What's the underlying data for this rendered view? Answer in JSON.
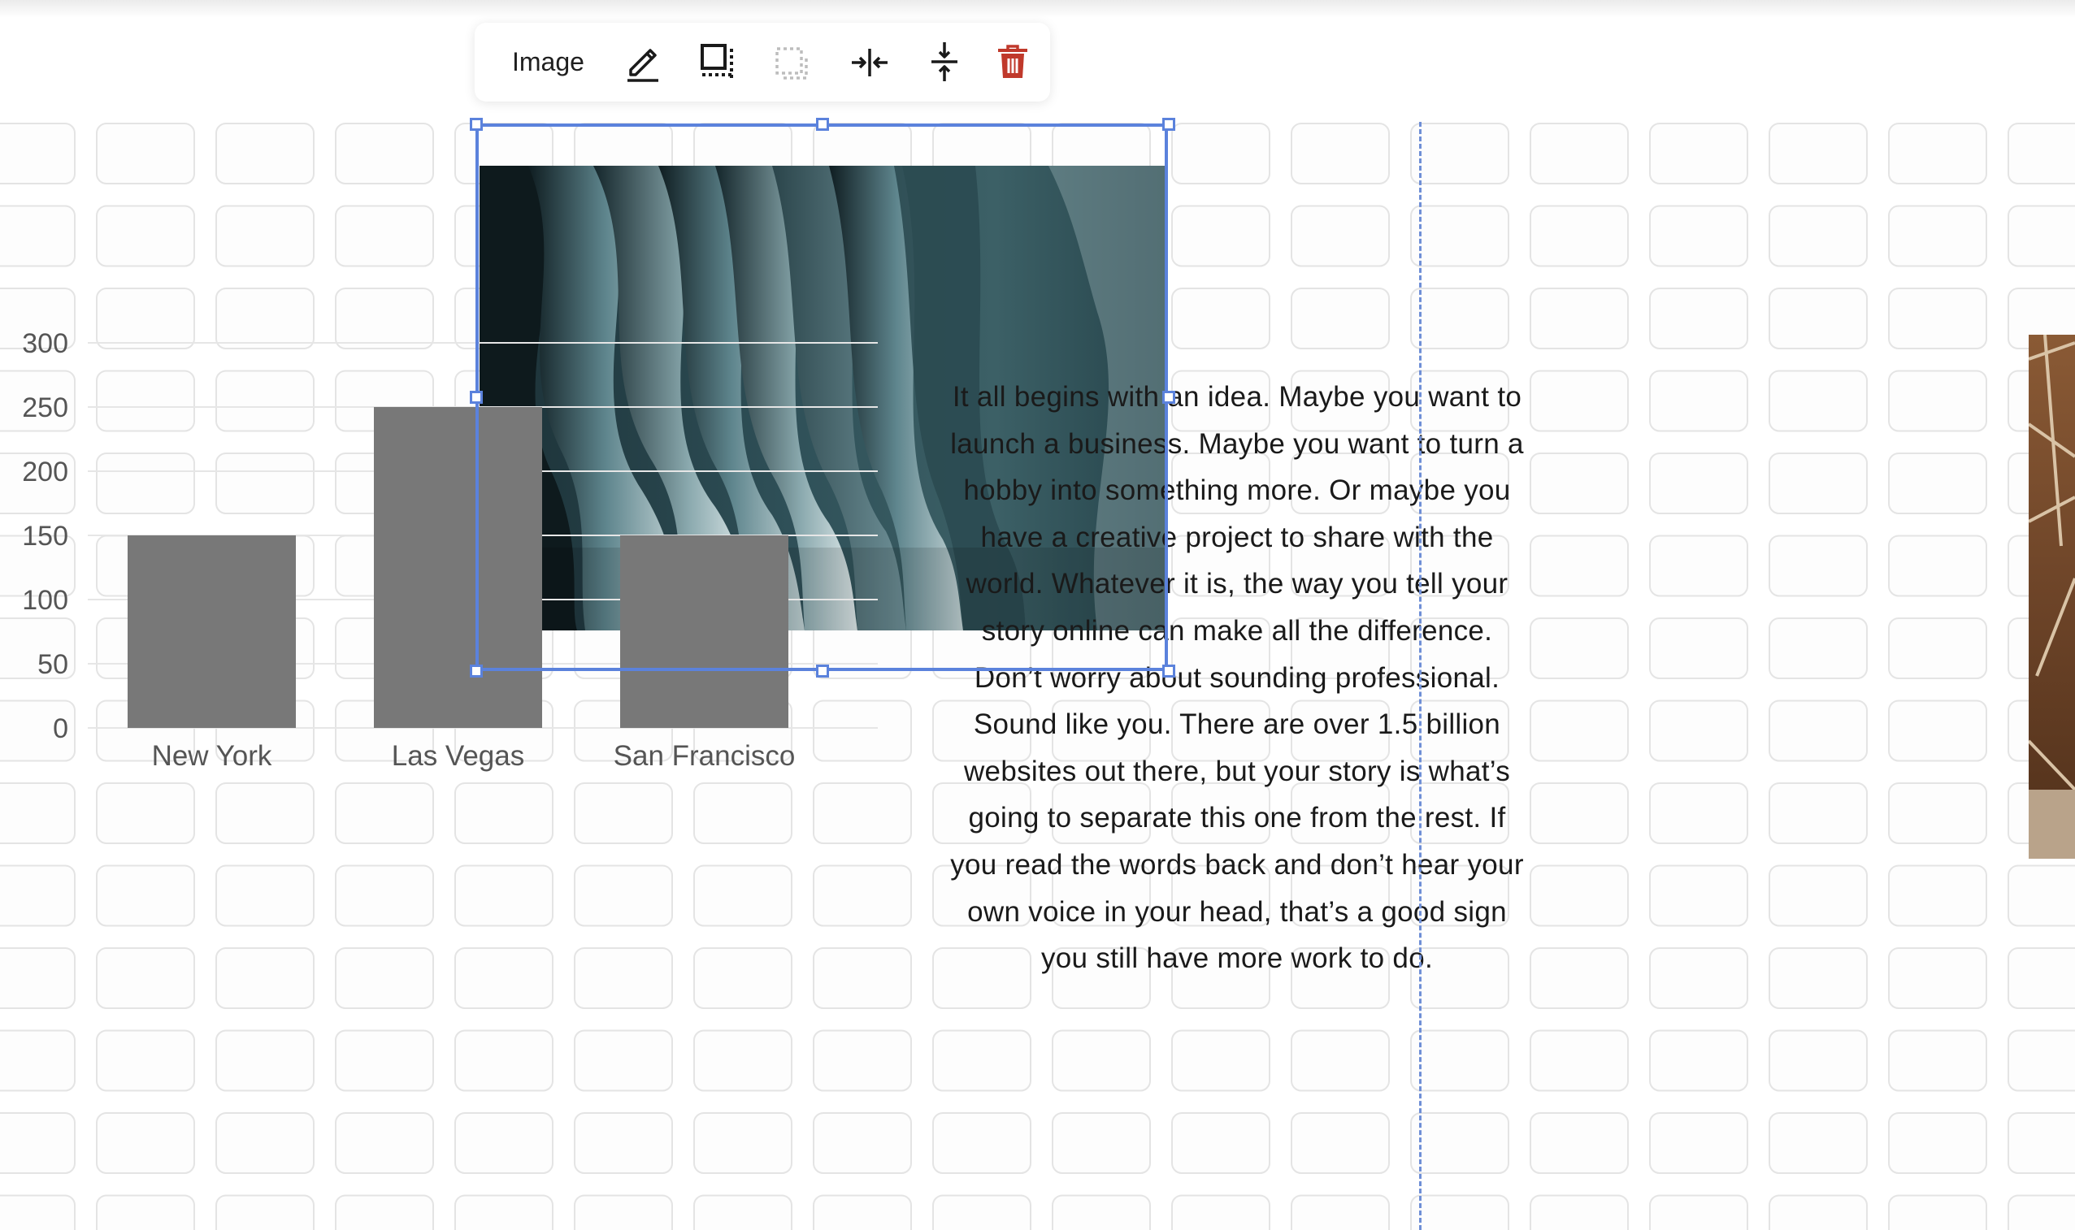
{
  "toolbar": {
    "label": "Image",
    "buttons": [
      {
        "name": "edit",
        "icon": "pencil-icon"
      },
      {
        "name": "crop",
        "icon": "crop-icon"
      },
      {
        "name": "remove-background",
        "icon": "dotted-square-icon",
        "disabled": true
      },
      {
        "name": "stretch-horizontal",
        "icon": "arrows-inward-horizontal-icon"
      },
      {
        "name": "stretch-vertical",
        "icon": "arrows-inward-vertical-icon"
      },
      {
        "name": "delete",
        "icon": "trash-icon"
      }
    ]
  },
  "chart_data": {
    "type": "bar",
    "categories": [
      "New York",
      "Las Vegas",
      "San Francisco"
    ],
    "values": [
      150,
      250,
      150
    ],
    "yticks": [
      0,
      50,
      100,
      150,
      200,
      250,
      300
    ],
    "ylim": [
      0,
      300
    ],
    "bar_color": "#787878",
    "title": "",
    "xlabel": "",
    "ylabel": ""
  },
  "paragraph": {
    "text": "It all begins with an idea. Maybe you want to launch a business. Maybe you want to turn a hobby into something more. Or maybe you have a creative project to share with the world. Whatever it is, the way you tell your story online can make all the difference. Don’t worry about sounding professional. Sound like you. There are over 1.5 billion websites out there, but your story is what’s going to separate this one from the rest. If you read the words back and don’t hear your own voice in your head, that’s a good sign you still have more work to do."
  },
  "colors": {
    "selection": "#5b82dc",
    "delete_icon": "#c0392b",
    "disabled_icon": "#bdbdbd",
    "icon": "#1a1a1a"
  }
}
